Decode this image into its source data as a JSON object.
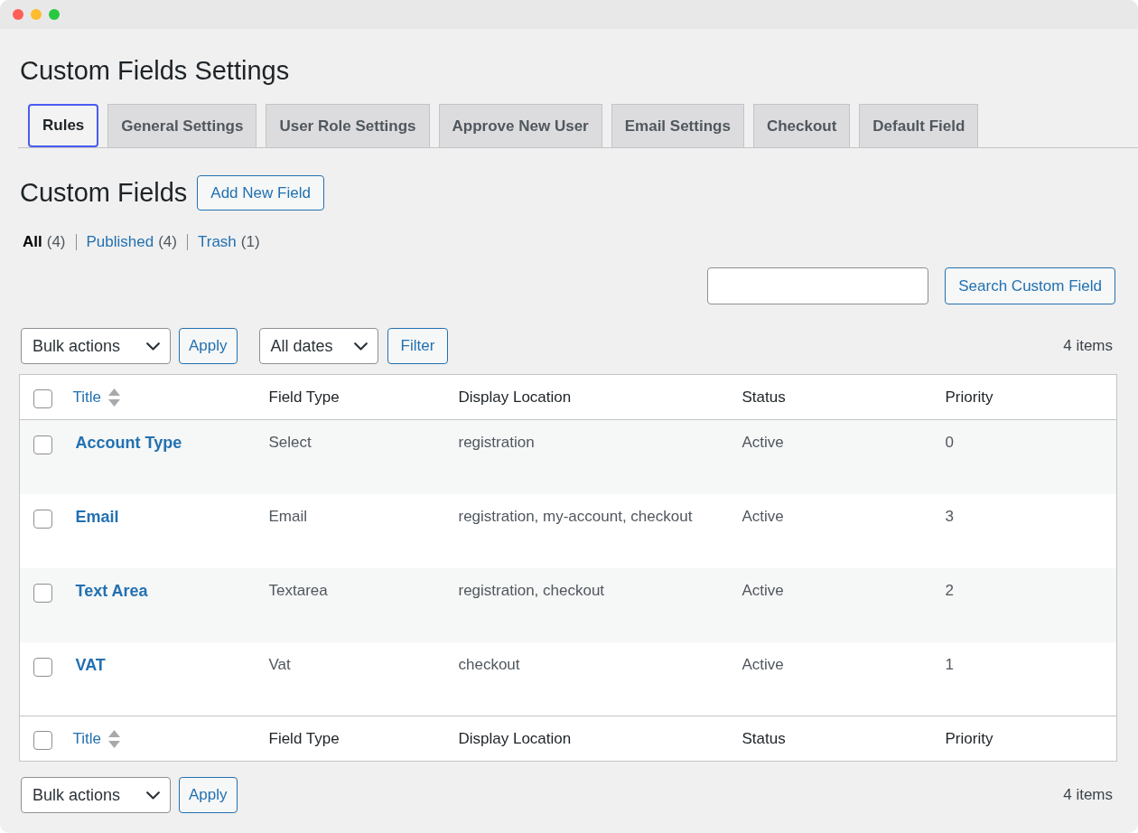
{
  "page_title": "Custom Fields Settings",
  "tabs": [
    {
      "label": "Rules",
      "selected": true
    },
    {
      "label": "General Settings",
      "selected": false
    },
    {
      "label": "User Role Settings",
      "selected": false
    },
    {
      "label": "Approve New User",
      "selected": false
    },
    {
      "label": "Email Settings",
      "selected": false
    },
    {
      "label": "Checkout",
      "selected": false
    },
    {
      "label": "Default Field",
      "selected": false
    }
  ],
  "section": {
    "heading": "Custom Fields",
    "add_button": "Add New Field"
  },
  "views": [
    {
      "label": "All",
      "count": "(4)",
      "selected": true
    },
    {
      "label": "Published",
      "count": "(4)",
      "selected": false
    },
    {
      "label": "Trash",
      "count": "(1)",
      "selected": false
    }
  ],
  "search": {
    "button": "Search Custom Field"
  },
  "top_nav": {
    "bulk_action": "Bulk actions",
    "apply_button": "Apply",
    "date_filter": "All dates",
    "filter_button": "Filter",
    "item_count": "4 items"
  },
  "table": {
    "header": {
      "checked": false,
      "columns": [
        {
          "label": "Title",
          "sortable": true
        },
        {
          "label": "Field Type",
          "sortable": false
        },
        {
          "label": "Display Location",
          "sortable": false
        },
        {
          "label": "Status",
          "sortable": false
        },
        {
          "label": "Priority",
          "sortable": false
        }
      ]
    },
    "rows": [
      {
        "checked": false,
        "title": "Account Type",
        "field_type": "Select",
        "display_location": "registration",
        "status": "Active",
        "priority": "0"
      },
      {
        "checked": false,
        "title": "Email",
        "field_type": "Email",
        "display_location": "registration, my-account, checkout",
        "status": "Active",
        "priority": "3"
      },
      {
        "checked": false,
        "title": "Text Area",
        "field_type": "Textarea",
        "display_location": "registration, checkout",
        "status": "Active",
        "priority": "2"
      },
      {
        "checked": false,
        "title": "VAT",
        "field_type": "Vat",
        "display_location": "checkout",
        "status": "Active",
        "priority": "1"
      }
    ],
    "footer": {
      "checked": false,
      "columns": [
        {
          "label": "Title",
          "sortable": true
        },
        {
          "label": "Field Type",
          "sortable": false
        },
        {
          "label": "Display Location",
          "sortable": false
        },
        {
          "label": "Status",
          "sortable": false
        },
        {
          "label": "Priority",
          "sortable": false
        }
      ]
    }
  },
  "bottom_nav": {
    "bulk_action": "Bulk actions",
    "apply_button": "Apply",
    "item_count": "4 items"
  }
}
